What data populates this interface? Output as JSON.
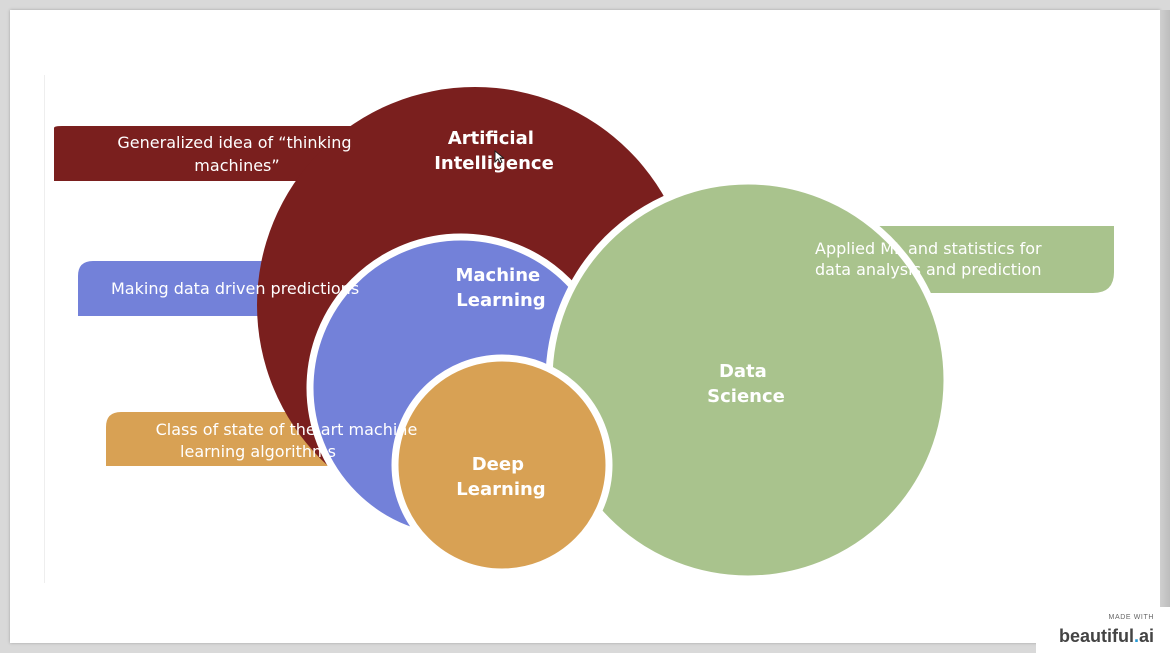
{
  "colors": {
    "artificial_intelligence": "#7a1f1e",
    "machine_learning": "#7381d9",
    "deep_learning": "#d8a154",
    "data_science": "#a9c38d"
  },
  "circles": {
    "ai": [
      "Artificial",
      "Intelligence"
    ],
    "ml": [
      "Machine",
      "Learning"
    ],
    "dl": [
      "Deep",
      "Learning"
    ],
    "ds": [
      "Data",
      "Science"
    ]
  },
  "callouts": {
    "ai": [
      "Generalized idea of “thinking",
      "machines”"
    ],
    "ml": [
      "Making data driven predictions"
    ],
    "dl": [
      "Class of state of the art machine",
      "learning algorithms"
    ],
    "ds": [
      "Applied ML and statistics for",
      "data analysis and prediction"
    ]
  },
  "badge": {
    "made_with": "MADE WITH",
    "brand_main": "beautiful",
    "brand_dot": ".",
    "brand_suffix": "ai"
  }
}
